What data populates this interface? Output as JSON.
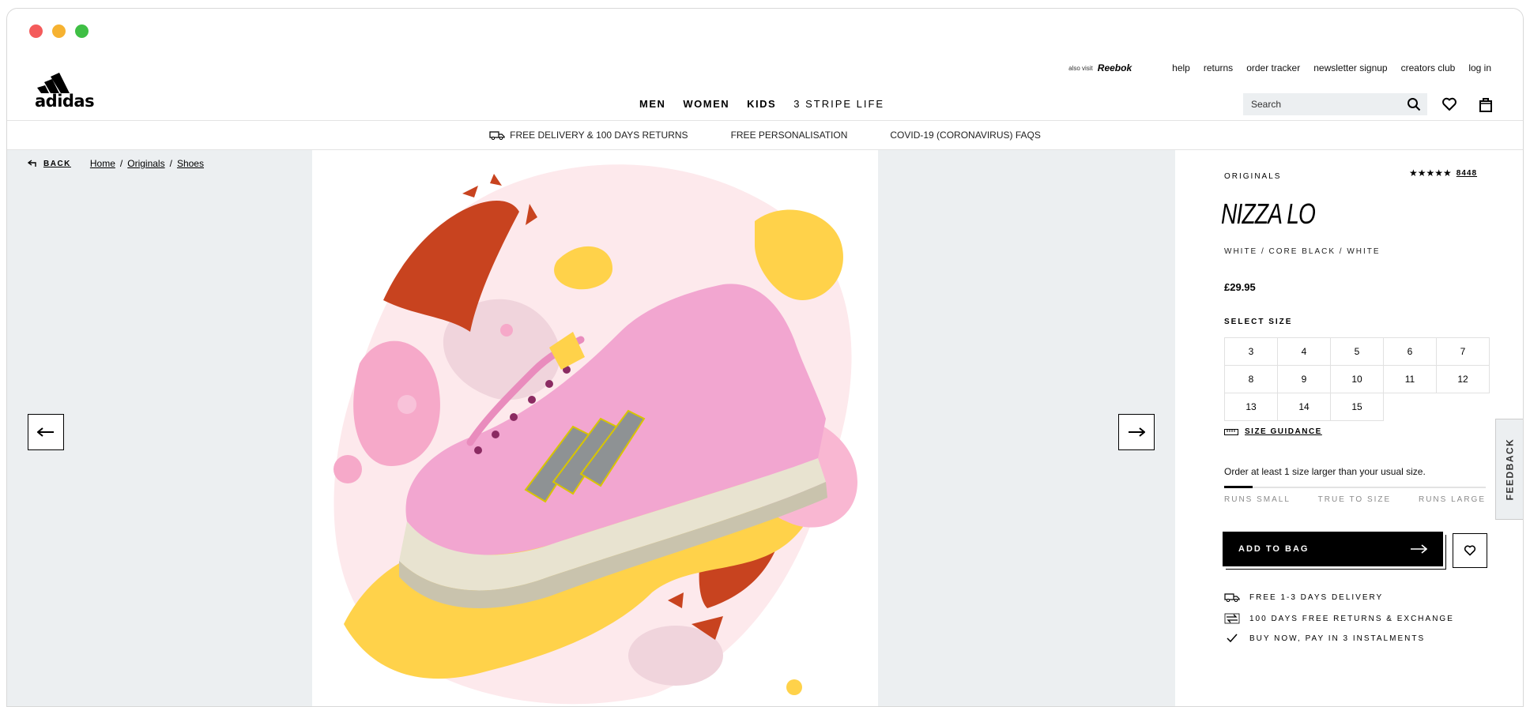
{
  "header": {
    "logo_text": "adidas",
    "also_visit": "also visit",
    "partner_brand": "Reebok",
    "util_links": [
      "help",
      "returns",
      "order tracker",
      "newsletter signup",
      "creators club",
      "log in"
    ],
    "nav": [
      "MEN",
      "WOMEN",
      "KIDS",
      "3 STRIPE LIFE"
    ],
    "search_placeholder": "Search"
  },
  "promo": [
    "FREE DELIVERY & 100 DAYS RETURNS",
    "FREE PERSONALISATION",
    "COVID-19 (CORONAVIRUS) FAQS"
  ],
  "breadcrumb": {
    "back": "BACK",
    "crumbs": [
      "Home",
      "Originals",
      "Shoes"
    ],
    "sep": "/"
  },
  "product": {
    "brand": "ORIGINALS",
    "rating_stars": "★★★★★",
    "rating_value": 4.5,
    "review_count": "8448",
    "name": "NIZZA LO",
    "colorway": "WHITE / CORE BLACK / WHITE",
    "price": "£29.95",
    "select_size_label": "SELECT SIZE",
    "sizes": [
      "3",
      "4",
      "5",
      "6",
      "7",
      "8",
      "9",
      "10",
      "11",
      "12",
      "13",
      "14",
      "15"
    ],
    "size_guidance": "SIZE GUIDANCE",
    "fit_note": "Order at least 1 size larger than your usual size.",
    "fit_labels": [
      "RUNS SMALL",
      "TRUE TO SIZE",
      "RUNS LARGE"
    ],
    "fit_level": 0.11,
    "add_to_bag": "ADD TO BAG",
    "usps": [
      "FREE 1-3 DAYS DELIVERY",
      "100 DAYS FREE RETURNS & EXCHANGE",
      "BUY NOW, PAY IN 3 INSTALMENTS"
    ]
  },
  "feedback": "FEEDBACK",
  "colors": {
    "gallery_bg": "#eceff1",
    "shoe_pink": "#f2a6d0",
    "sauce_red": "#c8431f",
    "cream_yellow": "#ffd24a"
  }
}
